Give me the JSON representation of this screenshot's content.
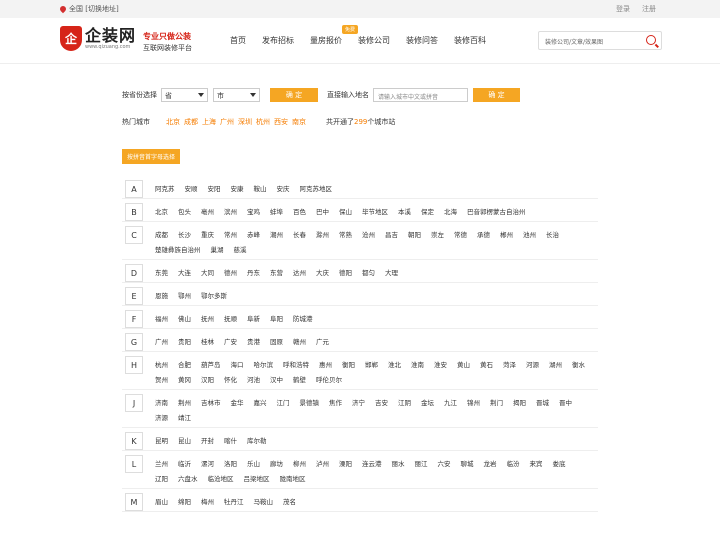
{
  "topbar": {
    "location": "全国 [切换地址]",
    "login": "登录",
    "register": "注册"
  },
  "logo": {
    "mark": "企",
    "name": "企装网",
    "url": "www.qizuang.com",
    "slogan1": "专业只做公装",
    "slogan2": "互联网装修平台"
  },
  "nav": [
    {
      "label": "首页"
    },
    {
      "label": "发布招标"
    },
    {
      "label": "量房报价",
      "badge": "免费"
    },
    {
      "label": "装修公司"
    },
    {
      "label": "装修问答"
    },
    {
      "label": "装修百科"
    }
  ],
  "search": {
    "placeholder": "装修公司/文章/效果图"
  },
  "filter": {
    "province_label": "按省份选择",
    "province_value": "省",
    "city_value": "市",
    "confirm1": "确 定",
    "direct_label": "直接输入地名",
    "input_placeholder": "请输入城市中文或拼音",
    "confirm2": "确 定"
  },
  "hot": {
    "label": "热门城市",
    "cities": [
      "北京",
      "成都",
      "上海",
      "广州",
      "深圳",
      "杭州",
      "西安",
      "南京"
    ],
    "total_prefix": "共开通了",
    "total_count": "299",
    "total_suffix": "个城市站"
  },
  "pinyin_tag": "按拼音首字母选择",
  "groups": [
    {
      "letter": "A",
      "cities": [
        "阿克苏",
        "安顺",
        "安阳",
        "安康",
        "鞍山",
        "安庆",
        "阿克苏地区"
      ]
    },
    {
      "letter": "B",
      "cities": [
        "北京",
        "包头",
        "亳州",
        "滨州",
        "宝鸡",
        "蚌埠",
        "百色",
        "巴中",
        "保山",
        "毕节地区",
        "本溪",
        "保定",
        "北海",
        "巴音郭楞蒙古自治州"
      ]
    },
    {
      "letter": "C",
      "cities": [
        "成都",
        "长沙",
        "重庆",
        "常州",
        "赤峰",
        "潮州",
        "长春",
        "滁州",
        "常熟",
        "沧州",
        "昌吉",
        "朝阳",
        "崇左",
        "常德",
        "承德",
        "郴州",
        "池州",
        "长治",
        "楚雄彝族自治州",
        "巢湖",
        "慈溪"
      ]
    },
    {
      "letter": "D",
      "cities": [
        "东莞",
        "大连",
        "大同",
        "德州",
        "丹东",
        "东营",
        "达州",
        "大庆",
        "德阳",
        "都匀",
        "大理"
      ]
    },
    {
      "letter": "E",
      "cities": [
        "恩施",
        "鄂州",
        "鄂尔多斯"
      ]
    },
    {
      "letter": "F",
      "cities": [
        "福州",
        "佛山",
        "抚州",
        "抚顺",
        "阜新",
        "阜阳",
        "防城港"
      ]
    },
    {
      "letter": "G",
      "cities": [
        "广州",
        "贵阳",
        "桂林",
        "广安",
        "贵港",
        "固原",
        "赣州",
        "广元"
      ]
    },
    {
      "letter": "H",
      "cities": [
        "杭州",
        "合肥",
        "葫芦岛",
        "海口",
        "哈尔滨",
        "呼和浩特",
        "惠州",
        "衡阳",
        "邯郸",
        "淮北",
        "淮南",
        "淮安",
        "黄山",
        "黄石",
        "菏泽",
        "河源",
        "湖州",
        "衡水",
        "贺州",
        "黄冈",
        "汉阳",
        "怀化",
        "河池",
        "汉中",
        "鹤壁",
        "呼伦贝尔"
      ]
    },
    {
      "letter": "J",
      "cities": [
        "济南",
        "荆州",
        "吉林市",
        "金华",
        "嘉兴",
        "江门",
        "景德镇",
        "焦作",
        "济宁",
        "吉安",
        "江阴",
        "金坛",
        "九江",
        "锦州",
        "荆门",
        "揭阳",
        "晋城",
        "晋中",
        "济源",
        "靖江"
      ]
    },
    {
      "letter": "K",
      "cities": [
        "昆明",
        "昆山",
        "开封",
        "喀什",
        "库尔勒"
      ]
    },
    {
      "letter": "L",
      "cities": [
        "兰州",
        "临沂",
        "漯河",
        "洛阳",
        "乐山",
        "廊坊",
        "柳州",
        "泸州",
        "溧阳",
        "连云港",
        "丽水",
        "丽江",
        "六安",
        "聊城",
        "龙岩",
        "临汾",
        "来宾",
        "娄底",
        "辽阳",
        "六盘水",
        "临沧地区",
        "吕梁地区",
        "陇南地区"
      ]
    },
    {
      "letter": "M",
      "cities": [
        "眉山",
        "绵阳",
        "梅州",
        "牡丹江",
        "马鞍山",
        "茂名"
      ]
    }
  ]
}
